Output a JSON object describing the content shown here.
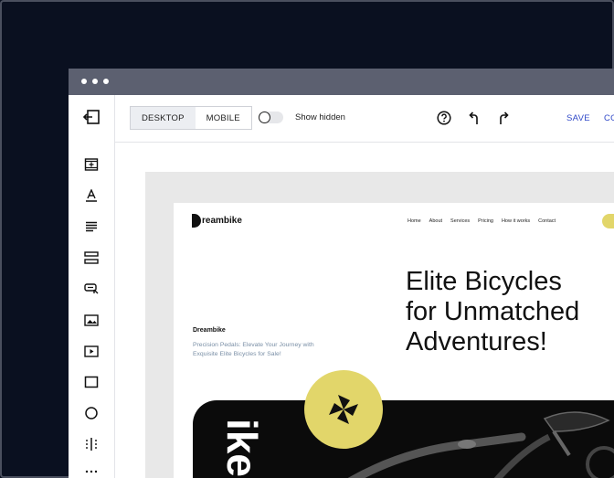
{
  "toolbar": {
    "view_desktop": "DESKTOP",
    "view_mobile": "MOBILE",
    "active_view": "DESKTOP",
    "show_hidden_label": "Show hidden",
    "show_hidden_on": false,
    "save_label": "SAVE",
    "comment_label": "COMMENT"
  },
  "sidebar": {
    "items": [
      {
        "icon": "exit-icon"
      },
      {
        "icon": "add-section-icon"
      },
      {
        "icon": "text-heading-icon"
      },
      {
        "icon": "paragraph-icon"
      },
      {
        "icon": "list-block-icon"
      },
      {
        "icon": "button-icon"
      },
      {
        "icon": "image-icon"
      },
      {
        "icon": "video-icon"
      },
      {
        "icon": "rectangle-icon"
      },
      {
        "icon": "circle-icon"
      },
      {
        "icon": "columns-icon"
      },
      {
        "icon": "more-icon"
      }
    ]
  },
  "site": {
    "logo": "Dreambike",
    "logo_text": "reambike",
    "nav": [
      "Home",
      "About",
      "Services",
      "Pricing",
      "How it works",
      "Contact"
    ],
    "hero_title_line1": "Elite Bicycles",
    "hero_title_line2": "for Unmatched",
    "hero_title_line3": "Adventures!",
    "brand": "Dreambike",
    "tagline": "Precision Pedals: Elevate Your Journey with Exquisite Elite Bicycles for Sale!",
    "hero_image_text": "ike"
  },
  "colors": {
    "accent": "#3049c8",
    "brand_yellow": "#e2d66a",
    "tagline": "#7a8fa6",
    "page_bg": "#0a1020"
  }
}
